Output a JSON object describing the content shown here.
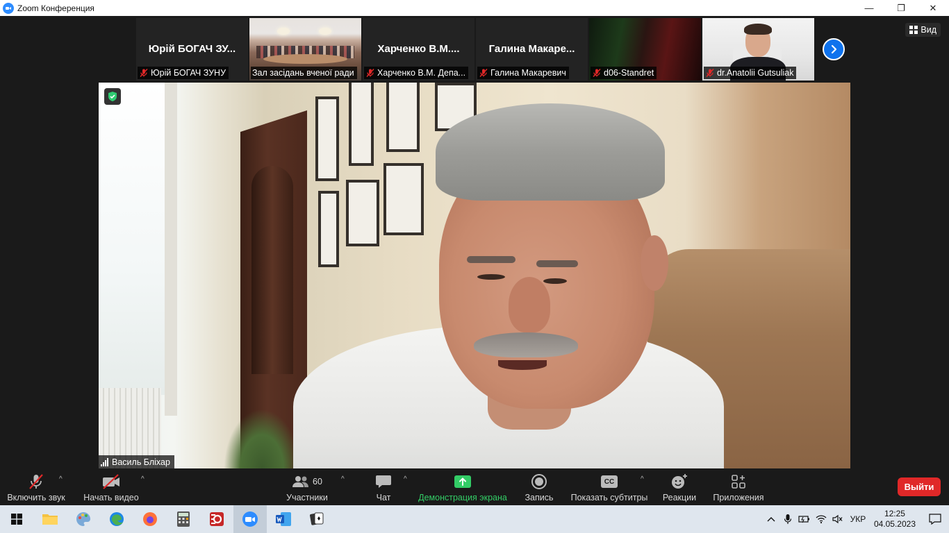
{
  "window": {
    "title": "Zoom Конференция",
    "minimize": "—",
    "restore": "❐",
    "close": "✕"
  },
  "view_button": {
    "label": "Вид"
  },
  "thumbnails": [
    {
      "big_name": "Юрій  БОГАЧ  ЗУ...",
      "caption": "Юрій БОГАЧ ЗУНУ",
      "muted": true
    },
    {
      "big_name": "",
      "caption": "Зал засідань вченої ради",
      "muted": false
    },
    {
      "big_name": "Харченко  В.М....",
      "caption": "Харченко В.М. Депа...",
      "muted": true
    },
    {
      "big_name": "Галина  Макаре...",
      "caption": "Галина Макаревич",
      "muted": true
    },
    {
      "big_name": "",
      "caption": "d06-Standret",
      "muted": true
    },
    {
      "big_name": "",
      "caption": "dr.Anatolii Gutsuliak",
      "muted": true
    }
  ],
  "speaker": {
    "name": "Василь Бліхар"
  },
  "toolbar": {
    "unmute": "Включить звук",
    "start_video": "Начать видео",
    "participants": "Участники",
    "participants_count": "60",
    "chat": "Чат",
    "share": "Демонстрация экрана",
    "record": "Запись",
    "captions": "Показать субтитры",
    "captions_icon_text": "CC",
    "reactions": "Реакции",
    "apps": "Приложения",
    "leave": "Выйти"
  },
  "taskbar": {
    "language": "УКР",
    "time": "12:25",
    "date": "04.05.2023"
  },
  "colors": {
    "accent": "#0e72ed",
    "share_green": "#33cc66",
    "leave_red": "#e02828",
    "muted_red": "#e02828"
  }
}
